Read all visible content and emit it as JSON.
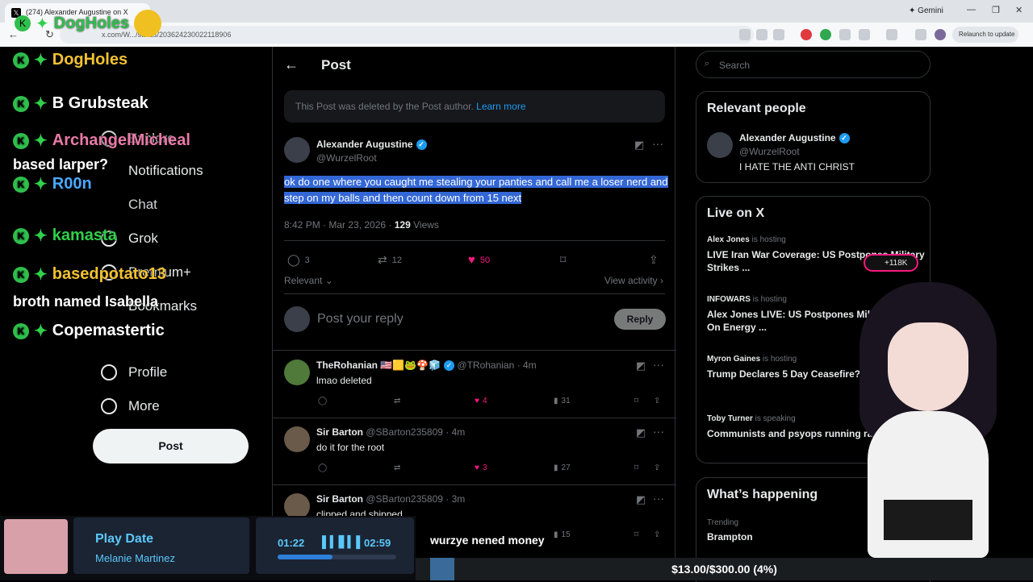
{
  "browser": {
    "tab_title": "(274) Alexander Augustine on X",
    "gemini_label": "Gemini",
    "url": "x.com/W.../status/203624230022118906",
    "relaunch_label": "Relaunch to update"
  },
  "overlay": {
    "title": "DogHoles"
  },
  "chat": [
    {
      "name": "DogHoles",
      "color": "#f2c231",
      "message": ""
    },
    {
      "name": "B Grubsteak",
      "color": "#ffffff",
      "message": ""
    },
    {
      "name": "ArchangelMicheal",
      "color": "#e97aa8",
      "message": "based larper?"
    },
    {
      "name": "R00n",
      "color": "#4aa8ff",
      "message": ""
    },
    {
      "name": "kamasta",
      "color": "#30d04a",
      "message": ""
    },
    {
      "name": "basedpotato13",
      "color": "#f2c231",
      "message": "broth named Isabella"
    },
    {
      "name": "Copemastertic",
      "color": "#ffffff",
      "message": ""
    }
  ],
  "nav": {
    "explore": "Explore",
    "notifications": "Notifications",
    "chat": "Chat",
    "grok": "Grok",
    "premium": "Premium+",
    "bookmarks": "Bookmarks",
    "profile": "Profile",
    "more": "More",
    "post_button": "Post"
  },
  "header": {
    "title": "Post"
  },
  "deleted_notice": {
    "text": "This Post was deleted by the Post author.",
    "link": "Learn more"
  },
  "tweet": {
    "author": "Alexander Augustine",
    "handle": "@WurzelRoot",
    "body": "ok do one where you caught me stealing your panties and call me a loser nerd and step on my balls and then count down from 15 next",
    "timestamp": "8:42 PM · Mar 23, 2026 · ",
    "views_count": "129",
    "views_label": "Views",
    "replies": "3",
    "reposts": "12",
    "likes": "50",
    "sort_label": "Relevant",
    "view_activity": "View activity"
  },
  "composer": {
    "placeholder": "Post your reply",
    "reply_button": "Reply"
  },
  "replies": [
    {
      "name": "TheRohanian 🇺🇸🟨🐸🍄🧊",
      "handle": "@TRohanian · 4m",
      "text": "lmao deleted",
      "likes": "4",
      "views": "31"
    },
    {
      "name": "Sir Barton",
      "handle": "@SBarton235809 · 4m",
      "text": "do it for the root",
      "likes": "3",
      "views": "27"
    },
    {
      "name": "Sir Barton",
      "handle": "@SBarton235809 · 3m",
      "text": "clipped and shipped",
      "likes": "",
      "views": "15"
    }
  ],
  "right": {
    "search_placeholder": "Search",
    "relevant_title": "Relevant people",
    "relevant_person": {
      "name": "Alexander Augustine",
      "handle": "@WurzelRoot",
      "bio": "I HATE THE ANTI CHRIST"
    },
    "live_title": "Live on X",
    "live": [
      {
        "host": "Alex Jones",
        "status": "is hosting",
        "title": "LIVE Iran War Coverage: US Postpones Military Strikes ..."
      },
      {
        "host": "INFOWARS",
        "status": "is hosting",
        "title": "Alex Jones LIVE: US Postpones Military Strikes On Energy ..."
      },
      {
        "host": "Myron Gaines",
        "status": "is hosting",
        "title": "Trump Declares 5 Day Ceasefire? W or L?"
      },
      {
        "host": "Toby Turner",
        "status": "is speaking",
        "title": "Communists and psyops running rampant on X?"
      }
    ],
    "live_listeners": "+118K",
    "happening_title": "What’s happening",
    "trending_label": "Trending",
    "trending_topic": "Brampton"
  },
  "media": {
    "track": "Play Date",
    "artist": "Melanie Martinez",
    "elapsed": "01:22",
    "duration": "02:59",
    "progress": 0.46
  },
  "stream_caption": "wurzye nened money",
  "goal": {
    "text": "$13.00/$300.00 (4%)",
    "progress": 0.04
  }
}
